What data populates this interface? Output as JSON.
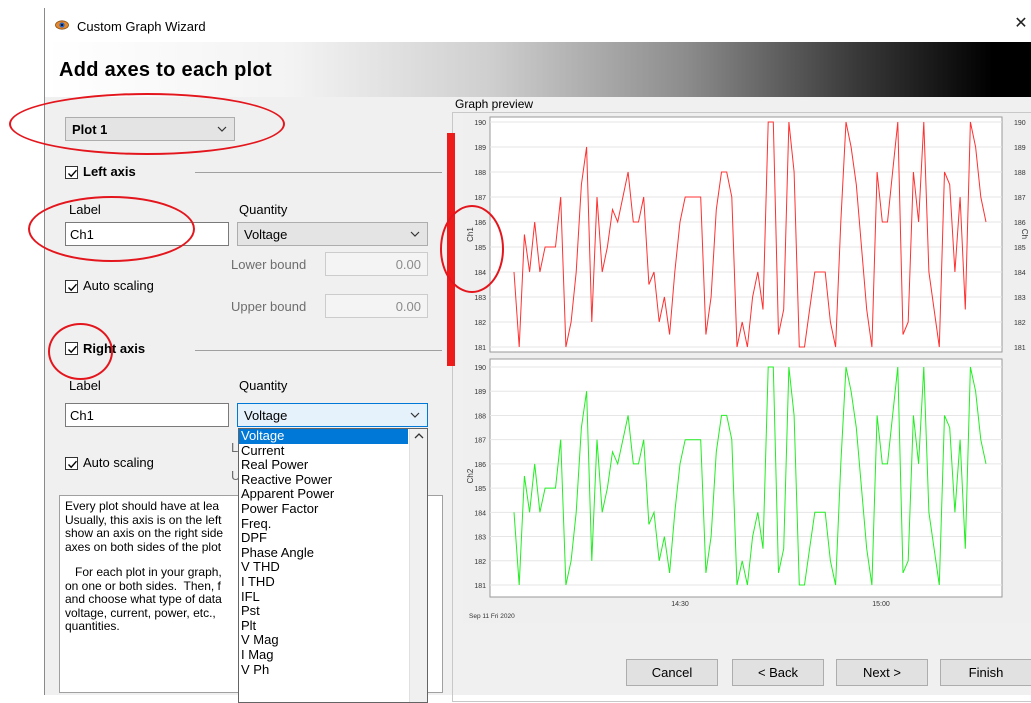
{
  "window": {
    "title": "Custom Graph Wizard",
    "close_glyph": "✕",
    "banner_title": "Add axes to each plot"
  },
  "plot_select": {
    "value": "Plot 1"
  },
  "left_axis": {
    "checkbox_label": "Left axis",
    "checked": true,
    "label_caption": "Label",
    "label_value": "Ch1",
    "quantity_caption": "Quantity",
    "quantity_value": "Voltage",
    "auto_scaling_label": "Auto scaling",
    "lower_bound_label": "Lower bound",
    "lower_bound_value": "0.00",
    "upper_bound_label": "Upper bound",
    "upper_bound_value": "0.00"
  },
  "right_axis": {
    "checkbox_label": "Right axis",
    "checked": true,
    "label_caption": "Label",
    "label_value": "Ch1",
    "quantity_caption": "Quantity",
    "quantity_value": "Voltage",
    "auto_scaling_label": "Auto scaling",
    "hidden_l1": "L",
    "hidden_l2": "U"
  },
  "quantity_dropdown": {
    "options": [
      "Voltage",
      "Current",
      "Real Power",
      "Reactive Power",
      "Apparent Power",
      "Power Factor",
      "Freq.",
      "DPF",
      "Phase Angle",
      "V THD",
      "I THD",
      "IFL",
      "Pst",
      "Plt",
      "V Mag",
      "I Mag",
      "V Ph"
    ],
    "selected_index": 0
  },
  "description": {
    "para1": "Every plot should have at lea\nUsually, this axis is on the left\nshow an axis on the right side\naxes on both sides of the plot",
    "para2": "   For each plot in your graph,\non one or both sides.  Then, f\nand choose what type of data\nvoltage, current, power, etc.,\nquantities."
  },
  "preview": {
    "group_label": "Graph preview",
    "top_plot_axis_label": "Ch1",
    "bottom_plot_axis_label": "Ch2",
    "right_axis_label_top": "Ch",
    "date_label": "Sep 11 Fri 2020",
    "time_ticks": [
      "14:30",
      "15:00"
    ],
    "y_ticks": [
      "181",
      "182",
      "183",
      "184",
      "185",
      "186",
      "187",
      "188",
      "189",
      "190"
    ]
  },
  "buttons": {
    "cancel": "Cancel",
    "back": "< Back",
    "next": "Next >",
    "finish": "Finish"
  },
  "colors": {
    "annotation_red": "#e4161d",
    "trace_top": "#ff3030",
    "trace_bottom": "#22ee22",
    "selection_blue": "#0078d7"
  },
  "chart_data": [
    {
      "type": "line",
      "title": "",
      "ylabel": "Ch1",
      "ylim": [
        181,
        190
      ],
      "xlabel": "Sep 11 Fri 2020",
      "x_ticks": [
        "14:30",
        "15:00"
      ],
      "series": [
        {
          "values": [
            184,
            181,
            185.5,
            184,
            186,
            184,
            185,
            185,
            185,
            187,
            181,
            182,
            184,
            187.5,
            189,
            182,
            187,
            184,
            185,
            186.5,
            186,
            187,
            188,
            186,
            186,
            187,
            183.5,
            184,
            182,
            183,
            181.5,
            184,
            186,
            187,
            187,
            187,
            187,
            181.5,
            183,
            186.5,
            188,
            188,
            187,
            181,
            182,
            181,
            183,
            184,
            182.5,
            190,
            190,
            181.5,
            182.5,
            190,
            188,
            181,
            181,
            182.5,
            184,
            184,
            184,
            182,
            181,
            186,
            190,
            189,
            187.5,
            185,
            182.5,
            181,
            188,
            186,
            186,
            188,
            190,
            181.5,
            182,
            188,
            186,
            190,
            184,
            182.5,
            181,
            188,
            187.5,
            184,
            187,
            182.5,
            190,
            189,
            187,
            186
          ]
        }
      ]
    },
    {
      "type": "line",
      "title": "",
      "ylabel": "Ch2",
      "ylim": [
        181,
        190
      ],
      "xlabel": "Sep 11 Fri 2020",
      "x_ticks": [
        "14:30",
        "15:00"
      ],
      "series": [
        {
          "values": [
            184,
            181,
            185.5,
            184,
            186,
            184,
            185,
            185,
            185,
            187,
            181,
            182,
            184,
            187.5,
            189,
            182,
            187,
            184,
            185,
            186.5,
            186,
            187,
            188,
            186,
            186,
            187,
            183.5,
            184,
            182,
            183,
            181.5,
            184,
            186,
            187,
            187,
            187,
            187,
            181.5,
            183,
            186.5,
            188,
            188,
            187,
            181,
            182,
            181,
            183,
            184,
            182.5,
            190,
            190,
            181.5,
            182.5,
            190,
            188,
            181,
            181,
            182.5,
            184,
            184,
            184,
            182,
            181,
            186,
            190,
            189,
            187.5,
            185,
            182.5,
            181,
            188,
            186,
            186,
            188,
            190,
            181.5,
            182,
            188,
            186,
            190,
            184,
            182.5,
            181,
            188,
            187.5,
            184,
            187,
            182.5,
            190,
            189,
            187,
            186
          ]
        }
      ]
    }
  ]
}
